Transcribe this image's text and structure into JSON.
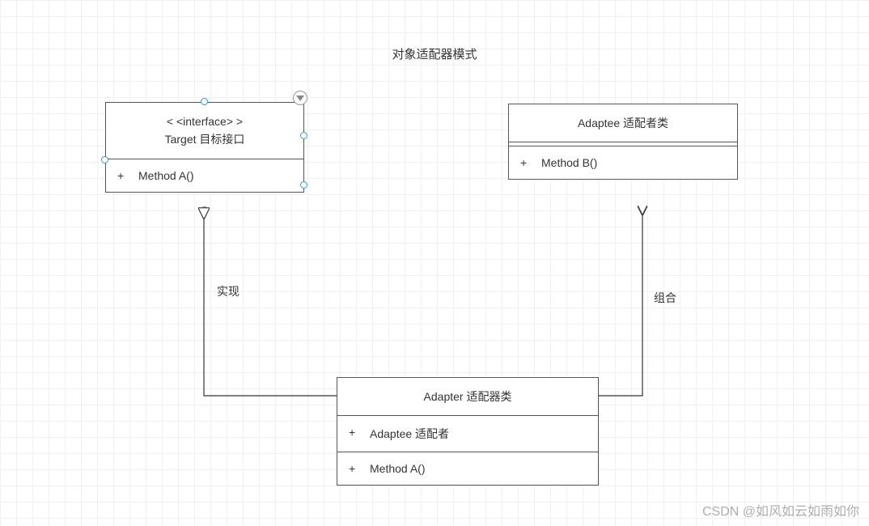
{
  "diagram": {
    "title": "对象适配器模式",
    "target": {
      "stereotype": "< <interface> >",
      "name": "Target 目标接口",
      "methods": [
        {
          "visibility": "+",
          "signature": "Method A()"
        }
      ]
    },
    "adaptee": {
      "name": "Adaptee 适配者类",
      "methods": [
        {
          "visibility": "+",
          "signature": "Method B()"
        }
      ]
    },
    "adapter": {
      "name": "Adapter 适配器类",
      "attributes": [
        {
          "visibility": "+",
          "signature": "Adaptee 适配者"
        }
      ],
      "methods": [
        {
          "visibility": "+",
          "signature": "Method A()"
        }
      ]
    },
    "edges": {
      "realize_label": "实现",
      "compose_label": "组合"
    },
    "watermark": "CSDN @如风如云如雨如你"
  }
}
